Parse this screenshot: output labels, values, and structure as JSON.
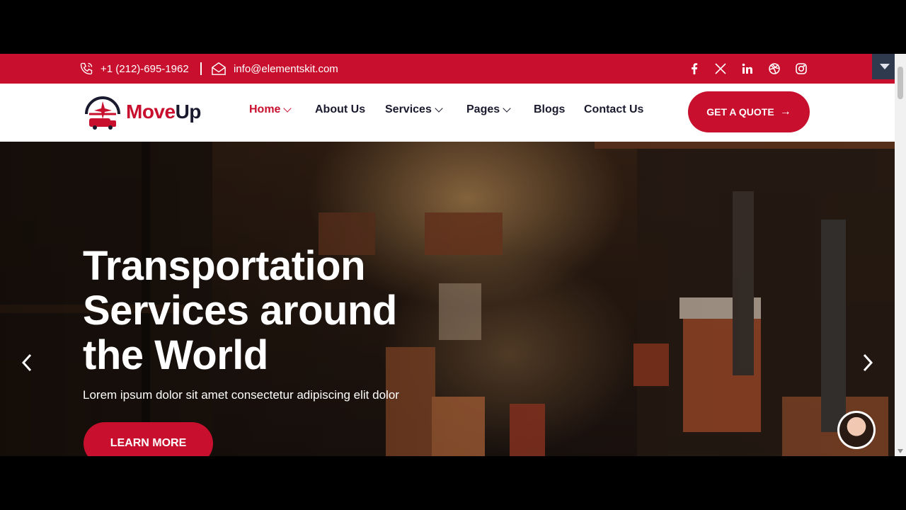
{
  "topbar": {
    "phone": "+1 (212)-695-1962",
    "email": "info@elementskit.com",
    "social_icons": [
      "facebook-icon",
      "x-icon",
      "linkedin-icon",
      "dribbble-icon",
      "instagram-icon"
    ]
  },
  "header": {
    "logo": {
      "part1": "Move",
      "part2": "Up"
    },
    "nav": [
      {
        "label": "Home",
        "active": true,
        "dropdown": true
      },
      {
        "label": "About Us",
        "dropdown": false
      },
      {
        "label": "Services",
        "dropdown": true
      },
      {
        "label": "Pages",
        "dropdown": true
      },
      {
        "label": "Blogs",
        "dropdown": false
      },
      {
        "label": "Contact Us",
        "dropdown": false
      }
    ],
    "cta": "GET A QUOTE"
  },
  "hero": {
    "title_lines": [
      "Transportation",
      "Services around",
      "the World"
    ],
    "subtitle": "Lorem ipsum dolor sit amet consectetur adipiscing elit dolor",
    "button": "LEARN MORE"
  },
  "colors": {
    "brand": "#c8102e",
    "dark": "#1a1a2e"
  }
}
